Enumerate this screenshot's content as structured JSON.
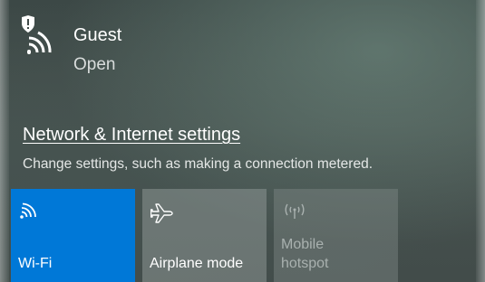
{
  "network": {
    "name": "Guest",
    "status": "Open",
    "icon": "wifi-secure-warning-icon"
  },
  "settings": {
    "link_label": "Network & Internet settings",
    "description": "Change settings, such as making a connection metered."
  },
  "quick_actions": [
    {
      "label": "Wi-Fi",
      "icon": "wifi-icon",
      "state": "on"
    },
    {
      "label": "Airplane mode",
      "icon": "airplane-icon",
      "state": "off"
    },
    {
      "label_lines": [
        "Mobile",
        "hotspot"
      ],
      "icon": "hotspot-icon",
      "state": "disabled"
    }
  ],
  "colors": {
    "accent": "#0078d7",
    "background": "#424c4a",
    "disabled_text": "#a9b1af"
  }
}
